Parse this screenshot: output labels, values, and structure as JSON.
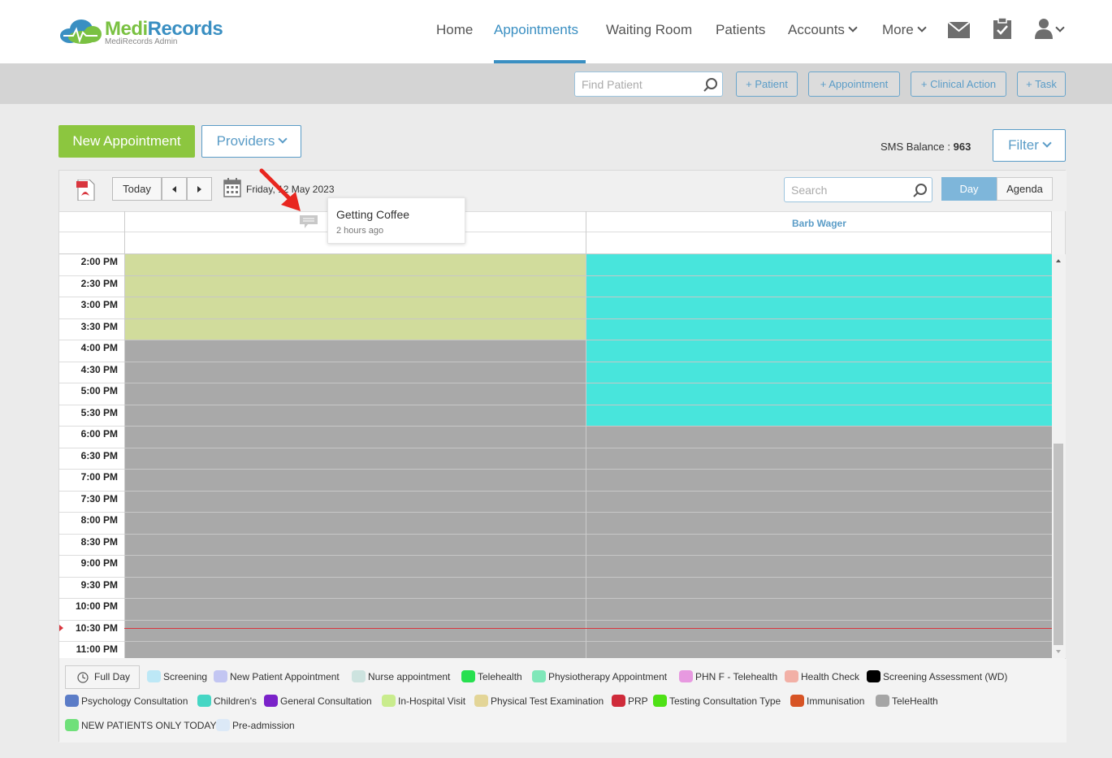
{
  "brand": {
    "name_part1": "Medi",
    "name_part2": "Records",
    "subtitle": "MediRecords Admin"
  },
  "nav": {
    "items": [
      {
        "label": "Home"
      },
      {
        "label": "Appointments"
      },
      {
        "label": "Waiting Room"
      },
      {
        "label": "Patients"
      },
      {
        "label": "Accounts"
      },
      {
        "label": "More"
      }
    ],
    "active": "Appointments"
  },
  "actions": {
    "find_placeholder": "Find Patient",
    "add_patient": "+ Patient",
    "add_appointment": "+ Appointment",
    "add_clinical_action": "+ Clinical Action",
    "add_task": "+ Task"
  },
  "controls": {
    "new_appointment": "New Appointment",
    "providers": "Providers",
    "sms_label": "SMS Balance :",
    "sms_value": "963",
    "filter": "Filter"
  },
  "calendar": {
    "today": "Today",
    "date": "Friday, 12 May 2023",
    "search_placeholder": "Search",
    "view_day": "Day",
    "view_agenda": "Agenda",
    "providers": [
      {
        "name": ""
      },
      {
        "name": "Barb Wager"
      }
    ],
    "times": [
      "2:00 PM",
      "2:30 PM",
      "3:00 PM",
      "3:30 PM",
      "4:00 PM",
      "4:30 PM",
      "5:00 PM",
      "5:30 PM",
      "6:00 PM",
      "6:30 PM",
      "7:00 PM",
      "7:30 PM",
      "8:00 PM",
      "8:30 PM",
      "9:00 PM",
      "9:30 PM",
      "10:00 PM",
      "10:30 PM",
      "11:00 PM"
    ],
    "col1_fill": [
      "avail",
      "avail",
      "avail",
      "avail",
      "blocked",
      "blocked",
      "blocked",
      "blocked",
      "blocked",
      "blocked",
      "blocked",
      "blocked",
      "blocked",
      "blocked",
      "blocked",
      "blocked",
      "blocked",
      "blocked",
      "blocked"
    ],
    "col2_fill": [
      "teal",
      "teal",
      "teal",
      "teal",
      "teal",
      "teal",
      "teal",
      "teal",
      "blocked",
      "blocked",
      "blocked",
      "blocked",
      "blocked",
      "blocked",
      "blocked",
      "blocked",
      "blocked",
      "blocked",
      "blocked"
    ],
    "colors": {
      "avail": "#d1dc9c",
      "teal": "#48e5dc",
      "blocked": "#a9a9a9"
    }
  },
  "tooltip": {
    "title": "Getting Coffee",
    "time": "2 hours ago"
  },
  "legend": {
    "full_day": "Full Day",
    "items": [
      {
        "label": "Screening",
        "color": "#bde8f6"
      },
      {
        "label": "New Patient Appointment",
        "color": "#c3c6f2"
      },
      {
        "label": "Nurse appointment",
        "color": "#cde3df"
      },
      {
        "label": "Telehealth",
        "color": "#27e04f"
      },
      {
        "label": "Physiotherapy Appointment",
        "color": "#7fe7b9"
      },
      {
        "label": "PHN F - Telehealth",
        "color": "#e799e0"
      },
      {
        "label": "Health Check",
        "color": "#f2b0a6"
      },
      {
        "label": "Screening Assessment (WD)",
        "color": "#000000"
      },
      {
        "label": "Psychology Consultation",
        "color": "#5b7cc7"
      },
      {
        "label": "Children's",
        "color": "#45d6c4"
      },
      {
        "label": "General Consultation",
        "color": "#7a22c9"
      },
      {
        "label": "In-Hospital Visit",
        "color": "#c9ec8d"
      },
      {
        "label": "Physical Test Examination",
        "color": "#e3d597"
      },
      {
        "label": "PRP",
        "color": "#cf2b3a"
      },
      {
        "label": "Testing Consultation Type",
        "color": "#4ee115"
      },
      {
        "label": "Immunisation",
        "color": "#d75425"
      },
      {
        "label": "TeleHealth",
        "color": "#a5a5a5"
      },
      {
        "label": "NEW PATIENTS ONLY TODAY",
        "color": "#6fe07a"
      },
      {
        "label": "Pre-admission",
        "color": "#dce9f7"
      }
    ]
  }
}
